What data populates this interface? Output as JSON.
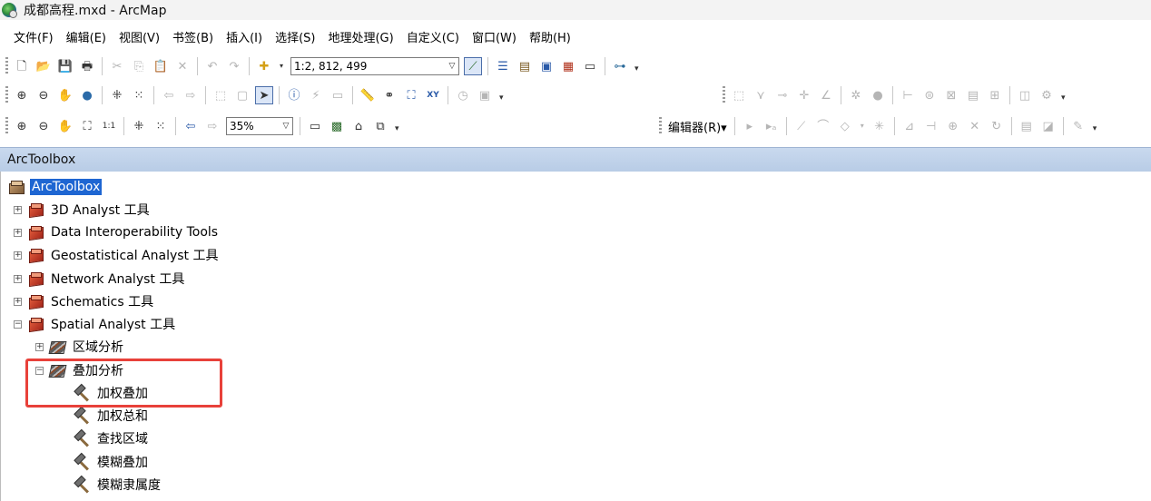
{
  "window": {
    "title": "成都高程.mxd - ArcMap"
  },
  "menu": [
    "文件(F)",
    "编辑(E)",
    "视图(V)",
    "书签(B)",
    "插入(I)",
    "选择(S)",
    "地理处理(G)",
    "自定义(C)",
    "窗口(W)",
    "帮助(H)"
  ],
  "toolbar": {
    "scale_value": "1:2, 812, 499",
    "zoom_value": "35%",
    "editor_label": "编辑器(R)▾"
  },
  "toolbox": {
    "pane_title": "ArcToolbox",
    "root_label": "ArcToolbox",
    "items": [
      {
        "label": "3D Analyst 工具",
        "expander": "+"
      },
      {
        "label": "Data Interoperability Tools",
        "expander": "+"
      },
      {
        "label": "Geostatistical Analyst 工具",
        "expander": "+"
      },
      {
        "label": "Network Analyst 工具",
        "expander": "+"
      },
      {
        "label": "Schematics 工具",
        "expander": "+"
      },
      {
        "label": "Spatial Analyst 工具",
        "expander": "−"
      }
    ],
    "sets": [
      {
        "label": "区域分析",
        "expander": "+"
      },
      {
        "label": "叠加分析",
        "expander": "−"
      }
    ],
    "tools": [
      "加权叠加",
      "加权总和",
      "查找区域",
      "模糊叠加",
      "模糊隶属度"
    ]
  },
  "colors": {
    "highlight_border": "#e8413a",
    "selected_bg": "#1e66d2",
    "pane_header": "#c9d9ee"
  }
}
